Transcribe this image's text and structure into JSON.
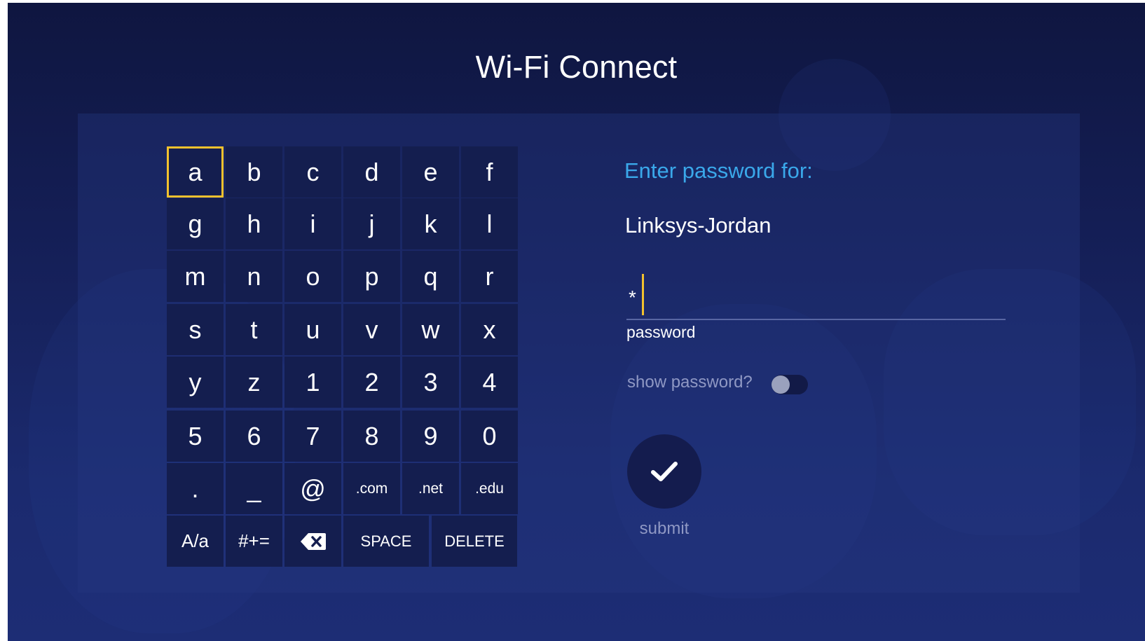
{
  "title": "Wi-Fi Connect",
  "colors": {
    "accent_blue": "#3aa8ea",
    "focus_yellow": "#f2c12e",
    "key_bg": "#141e4f",
    "background": "#141e55"
  },
  "keyboard": {
    "selected_key": "a",
    "rows": [
      [
        "a",
        "b",
        "c",
        "d",
        "e",
        "f"
      ],
      [
        "g",
        "h",
        "i",
        "j",
        "k",
        "l"
      ],
      [
        "m",
        "n",
        "o",
        "p",
        "q",
        "r"
      ],
      [
        "s",
        "t",
        "u",
        "v",
        "w",
        "x"
      ],
      [
        "y",
        "z",
        "1",
        "2",
        "3",
        "4"
      ],
      [
        "5",
        "6",
        "7",
        "8",
        "9",
        "0"
      ],
      [
        ".",
        "_",
        "@",
        ".com",
        ".net",
        ".edu"
      ]
    ],
    "bottom_row": {
      "case_toggle": "A/a",
      "symbols": "#+=",
      "backspace_icon": "backspace-icon",
      "space": "SPACE",
      "delete": "DELETE"
    }
  },
  "form": {
    "prompt": "Enter password for:",
    "network_name": "Linksys-Jordan",
    "password_value": "*",
    "password_label": "password",
    "show_password_label": "show password?",
    "show_password_enabled": false,
    "submit_icon": "checkmark-icon",
    "submit_label": "submit"
  }
}
